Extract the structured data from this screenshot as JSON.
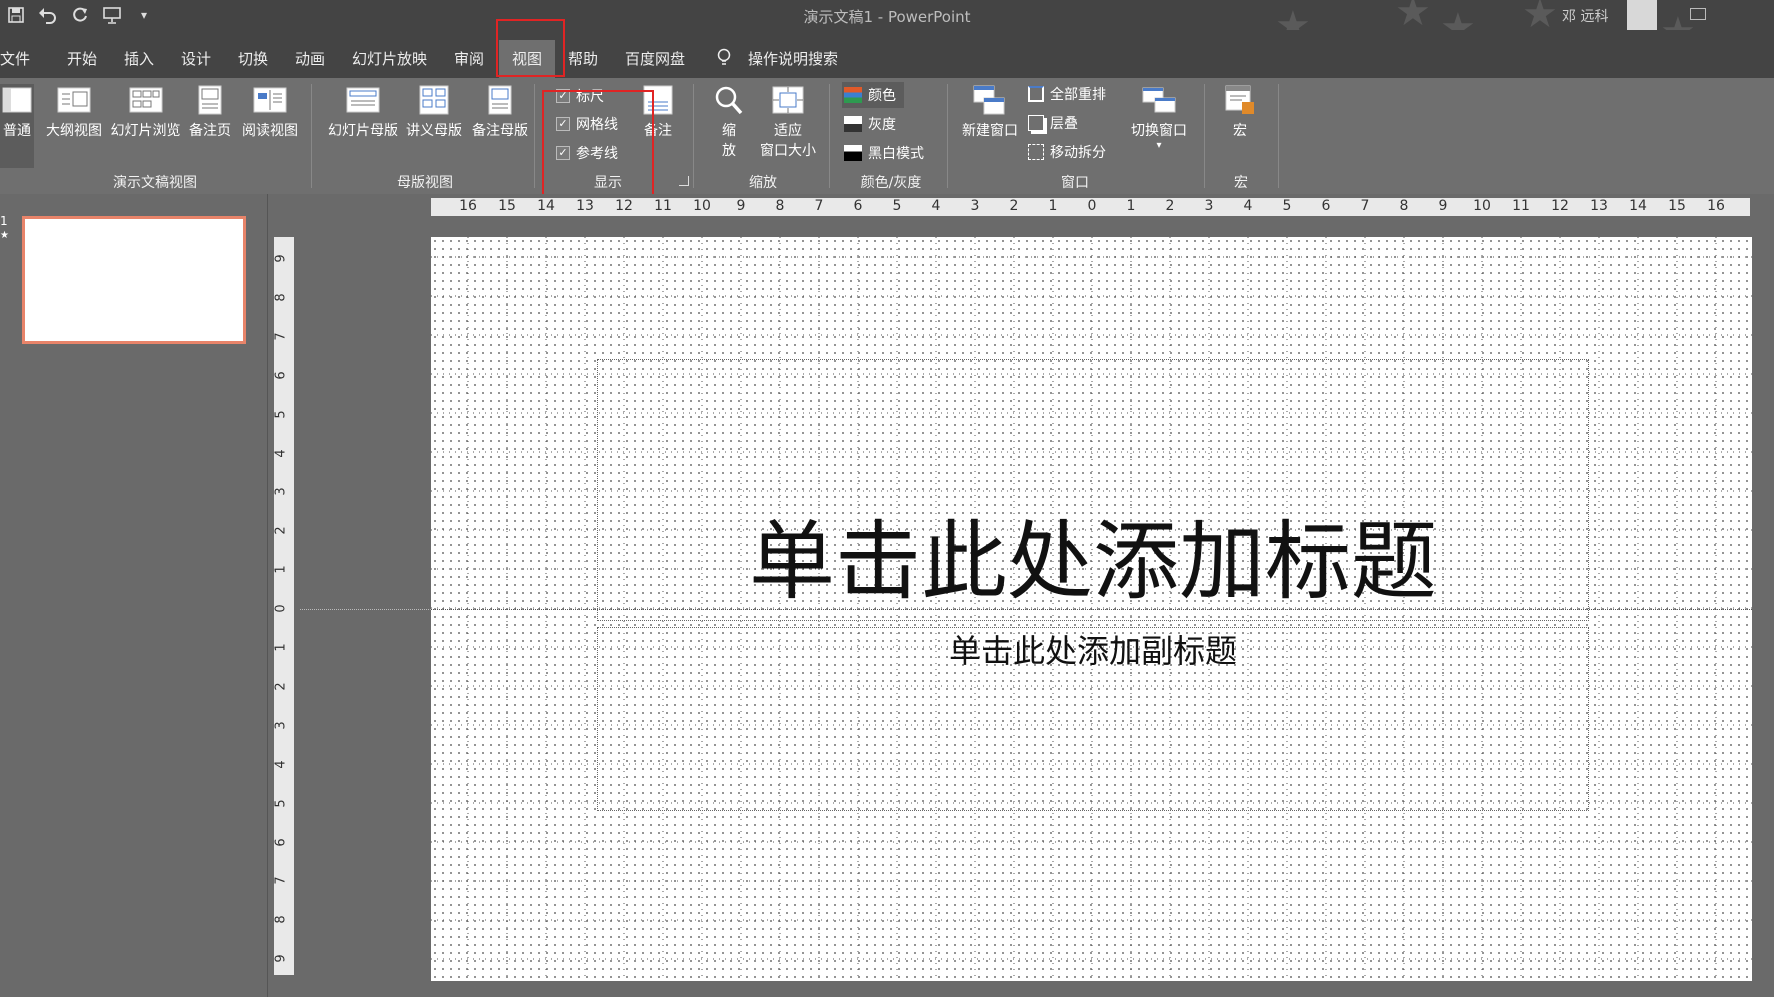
{
  "window": {
    "title": "演示文稿1  -  PowerPoint",
    "user": "邓 远科"
  },
  "qat": {
    "icons": [
      "save-icon",
      "undo-icon",
      "redo-icon",
      "present-icon",
      "customize-icon"
    ]
  },
  "tabs": [
    "文件",
    "开始",
    "插入",
    "设计",
    "切换",
    "动画",
    "幻灯片放映",
    "审阅",
    "视图",
    "帮助",
    "百度网盘"
  ],
  "tell_me": "操作说明搜索",
  "ribbon": {
    "presentation_views": {
      "group": "演示文稿视图",
      "items": [
        "普通",
        "大纲视图",
        "幻灯片浏览",
        "备注页",
        "阅读视图"
      ]
    },
    "master_views": {
      "group": "母版视图",
      "items": [
        "幻灯片母版",
        "讲义母版",
        "备注母版"
      ]
    },
    "show": {
      "group": "显示",
      "checks": [
        "标尺",
        "网格线",
        "参考线"
      ],
      "notes": "备注"
    },
    "zoom": {
      "group": "缩放",
      "zoom_label_1": "缩",
      "zoom_label_2": "放",
      "fit_label_1": "适应",
      "fit_label_2": "窗口大小"
    },
    "color": {
      "group": "颜色/灰度",
      "items": [
        "颜色",
        "灰度",
        "黑白模式"
      ]
    },
    "window": {
      "group": "窗口",
      "new_window": "新建窗口",
      "items": [
        "全部重排",
        "层叠",
        "移动拆分"
      ],
      "switch": "切换窗口"
    },
    "macros": {
      "group": "宏",
      "label": "宏"
    }
  },
  "ruler": {
    "h": [
      "16",
      "15",
      "14",
      "13",
      "12",
      "11",
      "10",
      "9",
      "8",
      "7",
      "6",
      "5",
      "4",
      "3",
      "2",
      "1",
      "0",
      "1",
      "2",
      "3",
      "4",
      "5",
      "6",
      "7",
      "8",
      "9",
      "10",
      "11",
      "12",
      "13",
      "14",
      "15",
      "16"
    ],
    "v": [
      "9",
      "8",
      "7",
      "6",
      "5",
      "4",
      "3",
      "2",
      "1",
      "0",
      "1",
      "2",
      "3",
      "4",
      "5",
      "6",
      "7",
      "8",
      "9"
    ]
  },
  "slide": {
    "title": "单击此处添加标题",
    "subtitle": "单击此处添加副标题",
    "thumb_number": "1"
  }
}
